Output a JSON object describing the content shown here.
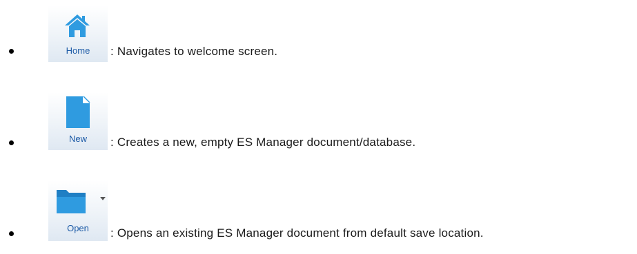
{
  "items": [
    {
      "icon": "home-icon",
      "label": "Home",
      "description": ": Navigates to welcome screen."
    },
    {
      "icon": "new-document-icon",
      "label": "New",
      "description": ": Creates a new, empty ES Manager document/database."
    },
    {
      "icon": "open-folder-icon",
      "label": "Open",
      "description": ": Opens an existing ES Manager document from default save location."
    }
  ],
  "colors": {
    "icon_blue": "#2f9be0",
    "label_blue": "#1c5aa6",
    "tile_gradient_end": "#dfe8f2"
  }
}
